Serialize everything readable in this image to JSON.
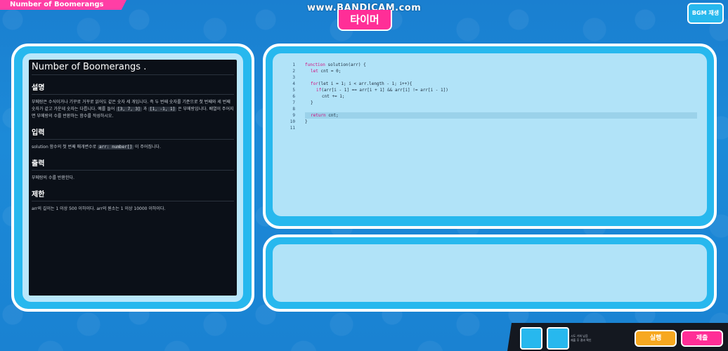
{
  "header": {
    "title": "Number of Boomerangs",
    "watermark": "www.BANDICAM.com",
    "timer_label": "타이머",
    "bgm_label": "BGM 재생"
  },
  "problem": {
    "title": "Number of Boomerangs .",
    "sections": [
      {
        "heading": "설명",
        "text_a": "부메랑은 수식이거나 기꾸로 거꾸로 읽어도 같은 숫자 세 개입니다. 즉 두 번째 숫자를 기준으로 첫 번째와 세 번째 숫자가 같고 가운데 숫자는 다릅니다. 예를 들어",
        "chip_a": "[3, 7, 3]",
        "text_b": "과",
        "chip_b": "[1, -1, 1]",
        "text_c": "은 부메랑입니다. 배열이 주어지면 부메랑의 수를 반환하는 함수를 작성하시오."
      },
      {
        "heading": "입력",
        "text_a": "solution 함수의 첫 번째 매개변수로",
        "chip_a": "arr: number[]",
        "text_b": "이 주어집니다."
      },
      {
        "heading": "출력",
        "text_a": "부메랑의 수를 반환한다."
      },
      {
        "heading": "제한",
        "text_a": "arr의 길이는 1 이상 500 이하이다. arr의 원소는 1 이상 10000 이하이다."
      }
    ]
  },
  "editor": {
    "line_numbers": [
      "1",
      "2",
      "3",
      "4",
      "5",
      "6",
      "7",
      "8",
      "9",
      "10",
      "11"
    ],
    "lines": [
      {
        "kw": "function",
        "rest": " solution(arr) {"
      },
      {
        "kw": "let",
        "rest": " cnt = 0;",
        "indent": 1
      },
      {
        "kw": "",
        "rest": ""
      },
      {
        "kw": "for",
        "rest": "(let i = 1; i < arr.length - 1; i++){",
        "indent": 1
      },
      {
        "kw": "if",
        "rest": "(arr[i - 1] == arr[i + 1] && arr[i] != arr[i - 1])",
        "indent": 2
      },
      {
        "kw": "",
        "rest": "cnt += 1;",
        "indent": 3
      },
      {
        "kw": "",
        "rest": "}",
        "indent": 1
      },
      {
        "kw": "",
        "rest": ""
      },
      {
        "kw": "return",
        "rest": " cnt;",
        "indent": 1
      },
      {
        "kw": "",
        "rest": "}"
      },
      {
        "kw": "",
        "rest": ""
      }
    ],
    "active_line": 9
  },
  "footer": {
    "hint_line1": "시도 기회 남음",
    "hint_line2": "제출 후 결과 확인",
    "run_label": "실행",
    "submit_label": "제출"
  },
  "colors": {
    "accent_pink": "#ff2e97",
    "accent_cyan": "#27b8ee",
    "run_orange": "#f7a820"
  }
}
